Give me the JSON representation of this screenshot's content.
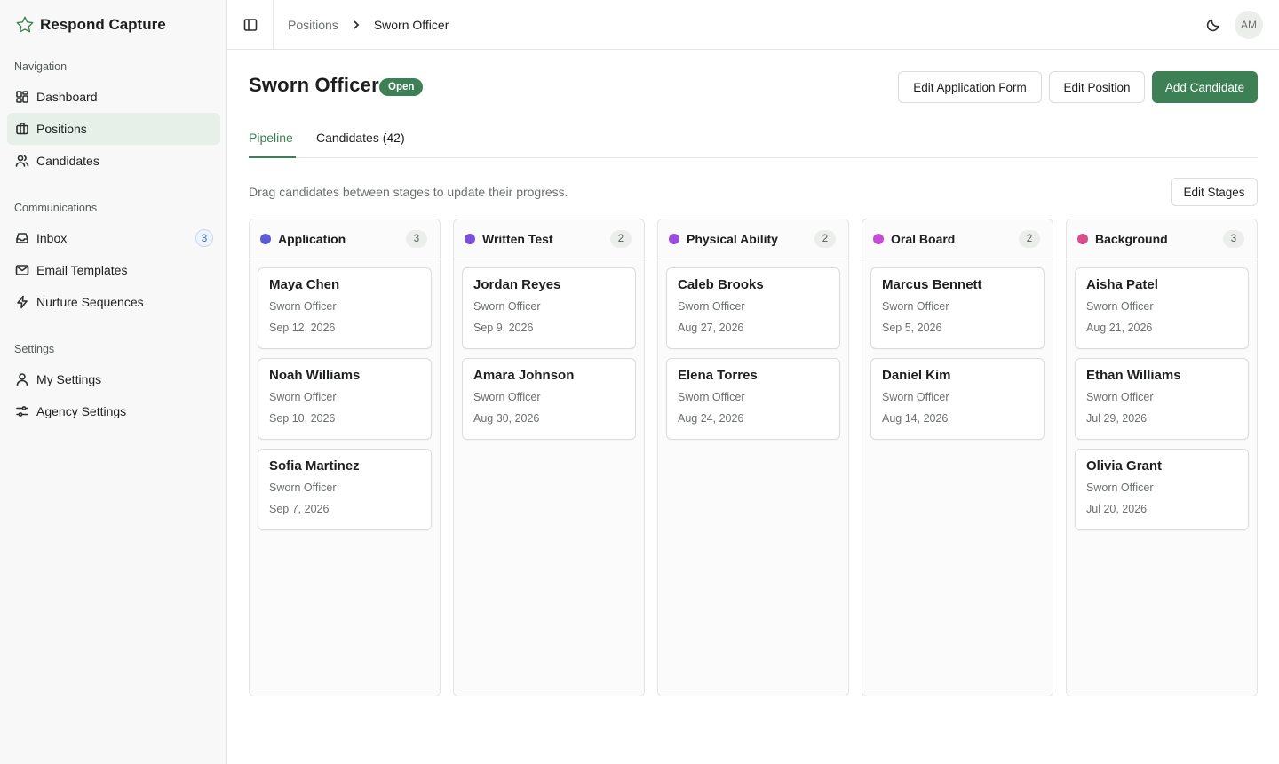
{
  "brand": {
    "name": "Respond Capture"
  },
  "sidebar": {
    "groups": [
      {
        "label": "Navigation",
        "items": [
          {
            "label": "Dashboard",
            "icon": "dashboard-icon"
          },
          {
            "label": "Positions",
            "icon": "briefcase-icon",
            "active": true
          },
          {
            "label": "Candidates",
            "icon": "users-icon"
          }
        ]
      },
      {
        "label": "Communications",
        "items": [
          {
            "label": "Inbox",
            "icon": "inbox-icon",
            "badge": "3"
          },
          {
            "label": "Email Templates",
            "icon": "mail-icon"
          },
          {
            "label": "Nurture Sequences",
            "icon": "zap-icon"
          }
        ]
      },
      {
        "label": "Settings",
        "items": [
          {
            "label": "My Settings",
            "icon": "user-icon"
          },
          {
            "label": "Agency Settings",
            "icon": "sliders-icon"
          }
        ]
      }
    ]
  },
  "header": {
    "breadcrumb": {
      "parent": "Positions",
      "current": "Sworn Officer"
    },
    "avatar_initials": "AM"
  },
  "page": {
    "title": "Sworn Officer",
    "status": "Open",
    "status_color": "#3d8055",
    "buttons": {
      "edit_form": "Edit Application Form",
      "edit_position": "Edit Position",
      "add_candidate": "Add Candidate"
    },
    "tabs": [
      {
        "label": "Pipeline",
        "active": true
      },
      {
        "label": "Candidates (42)",
        "active": false
      }
    ],
    "hint": "Drag candidates between stages to update their progress.",
    "edit_stages": "Edit Stages"
  },
  "stages": [
    {
      "name": "Application",
      "count": "3",
      "color": "#5b5bd6",
      "cards": [
        {
          "name": "Maya Chen",
          "role": "Sworn Officer",
          "date": "Sep 12, 2026"
        },
        {
          "name": "Noah Williams",
          "role": "Sworn Officer",
          "date": "Sep 10, 2026"
        },
        {
          "name": "Sofia Martinez",
          "role": "Sworn Officer",
          "date": "Sep 7, 2026"
        }
      ]
    },
    {
      "name": "Written Test",
      "count": "2",
      "color": "#7c4fdb",
      "cards": [
        {
          "name": "Jordan Reyes",
          "role": "Sworn Officer",
          "date": "Sep 9, 2026"
        },
        {
          "name": "Amara Johnson",
          "role": "Sworn Officer",
          "date": "Aug 30, 2026"
        }
      ]
    },
    {
      "name": "Physical Ability",
      "count": "2",
      "color": "#9a4fdb",
      "cards": [
        {
          "name": "Caleb Brooks",
          "role": "Sworn Officer",
          "date": "Aug 27, 2026"
        },
        {
          "name": "Elena Torres",
          "role": "Sworn Officer",
          "date": "Aug 24, 2026"
        }
      ]
    },
    {
      "name": "Oral Board",
      "count": "2",
      "color": "#c44fd6",
      "cards": [
        {
          "name": "Marcus Bennett",
          "role": "Sworn Officer",
          "date": "Sep 5, 2026"
        },
        {
          "name": "Daniel Kim",
          "role": "Sworn Officer",
          "date": "Aug 14, 2026"
        }
      ]
    },
    {
      "name": "Background",
      "count": "3",
      "color": "#d94f8c",
      "cards": [
        {
          "name": "Aisha Patel",
          "role": "Sworn Officer",
          "date": "Aug 21, 2026"
        },
        {
          "name": "Ethan Williams",
          "role": "Sworn Officer",
          "date": "Jul 29, 2026"
        },
        {
          "name": "Olivia Grant",
          "role": "Sworn Officer",
          "date": "Jul 20, 2026"
        }
      ]
    }
  ]
}
